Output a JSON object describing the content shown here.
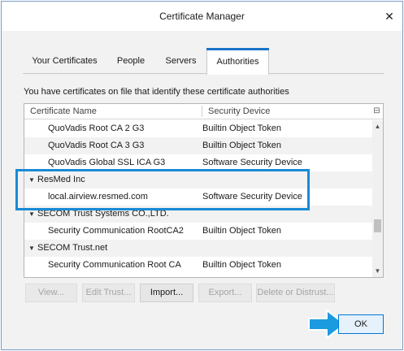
{
  "window": {
    "title": "Certificate Manager",
    "close_glyph": "✕"
  },
  "tabs": [
    {
      "label": "Your Certificates",
      "selected": false
    },
    {
      "label": "People",
      "selected": false
    },
    {
      "label": "Servers",
      "selected": false
    },
    {
      "label": "Authorities",
      "selected": true
    }
  ],
  "description": "You have certificates on file that identify these certificate authorities",
  "tree": {
    "columns": {
      "name": "Certificate Name",
      "device": "Security Device"
    },
    "rows": [
      {
        "type": "item",
        "name": "QuoVadis Root CA 2 G3",
        "device": "Builtin Object Token"
      },
      {
        "type": "item",
        "name": "QuoVadis Root CA 3 G3",
        "device": "Builtin Object Token"
      },
      {
        "type": "item",
        "name": "QuoVadis Global SSL ICA G3",
        "device": "Software Security Device"
      },
      {
        "type": "group",
        "name": "ResMed Inc",
        "device": ""
      },
      {
        "type": "item",
        "name": "local.airview.resmed.com",
        "device": "Software Security Device"
      },
      {
        "type": "group",
        "name": "SECOM Trust Systems CO.,LTD.",
        "device": ""
      },
      {
        "type": "item",
        "name": "Security Communication RootCA2",
        "device": "Builtin Object Token"
      },
      {
        "type": "group",
        "name": "SECOM Trust.net",
        "device": ""
      },
      {
        "type": "item",
        "name": "Security Communication Root CA",
        "device": "Builtin Object Token"
      }
    ]
  },
  "buttons": {
    "view": "View...",
    "edit_trust": "Edit Trust...",
    "import": "Import...",
    "export": "Export...",
    "delete": "Delete or Distrust...",
    "ok": "OK"
  },
  "colors": {
    "accent": "#1a8ad6",
    "tab_indicator": "#1a73c9"
  },
  "icons": {
    "close": "close-icon",
    "expanded": "twisty-expanded-icon",
    "column_picker": "column-picker-icon",
    "pointer": "arrow-pointer-icon"
  }
}
